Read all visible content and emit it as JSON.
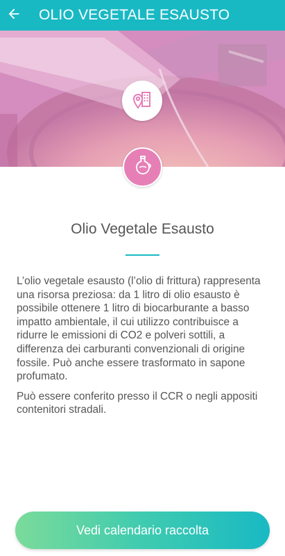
{
  "header": {
    "title": "OLIO VEGETALE ESAUSTO",
    "back_icon": "arrow-left-icon"
  },
  "hero": {
    "map_icon": "map-pin-building-icon",
    "category_icon": "oil-bottle-icon",
    "tint_color": "#e77fb7"
  },
  "content": {
    "title": "Olio Vegetale Esausto",
    "paragraphs": [
      "L’olio vegetale esausto (l’olio di frittura) rappresenta una risorsa preziosa: da 1 litro di olio esausto è possibile ottenere 1 litro di biocarburante a basso impatto ambientale, il cui utilizzo contribuisce a ridurre le emissioni di CO2 e polveri sottili, a differenza dei carburanti convenzionali di origine fossile. Può anche essere trasformato in sapone profumato.",
      "Può essere conferito presso il CCR o negli appositi contenitori stradali."
    ]
  },
  "cta": {
    "label": "Vedi calendario raccolta"
  },
  "colors": {
    "accent": "#19b9c4",
    "text": "#555555",
    "button_start": "#7bdb9a",
    "button_end": "#19b9c4"
  }
}
